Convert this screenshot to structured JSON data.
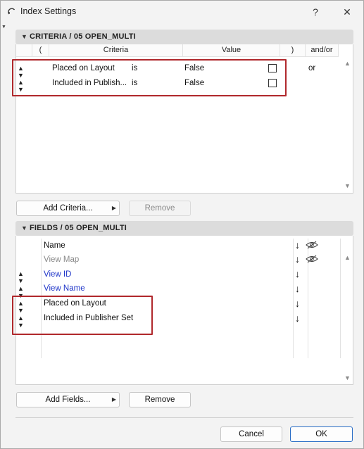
{
  "window": {
    "title": "Index Settings",
    "help_label": "?",
    "close_label": "✕"
  },
  "criteria": {
    "header": "CRITERIA / 05 OPEN_MULTI",
    "columns": {
      "open_paren": "(",
      "criteria": "Criteria",
      "value": "Value",
      "close_paren": ")",
      "andor": "and/or"
    },
    "rows": [
      {
        "criteria": "Placed on Layout",
        "operator": "is",
        "value": "False",
        "checked": false,
        "andor": "or"
      },
      {
        "criteria": "Included in Publish...",
        "operator": "is",
        "value": "False",
        "checked": false,
        "andor": ""
      }
    ],
    "add_button": "Add Criteria...",
    "remove_button": "Remove"
  },
  "fields": {
    "header": "FIELDS / 05 OPEN_MULTI",
    "columns": {
      "name": "Name"
    },
    "rows": [
      {
        "name": "View Map",
        "style": "gray",
        "handle": false,
        "sort_arrow": "↓",
        "visibility_icon": "hidden-eye-icon"
      },
      {
        "name": "View ID",
        "style": "blue",
        "handle": true,
        "sort_arrow": "↓",
        "visibility_icon": ""
      },
      {
        "name": "View Name",
        "style": "blue",
        "handle": true,
        "sort_arrow": "↓",
        "visibility_icon": ""
      },
      {
        "name": "Placed on Layout",
        "style": "normal",
        "handle": true,
        "sort_arrow": "↓",
        "visibility_icon": ""
      },
      {
        "name": "Included in Publisher Set",
        "style": "normal",
        "handle": true,
        "sort_arrow": "↓",
        "visibility_icon": ""
      }
    ],
    "header_sort_arrow": "↓",
    "add_button": "Add Fields...",
    "remove_button": "Remove"
  },
  "footer": {
    "cancel_button": "Cancel",
    "ok_button": "OK"
  },
  "colors": {
    "highlight_box": "#b0282c",
    "link_blue": "#1f35c8",
    "ok_border": "#2a6ec6"
  }
}
